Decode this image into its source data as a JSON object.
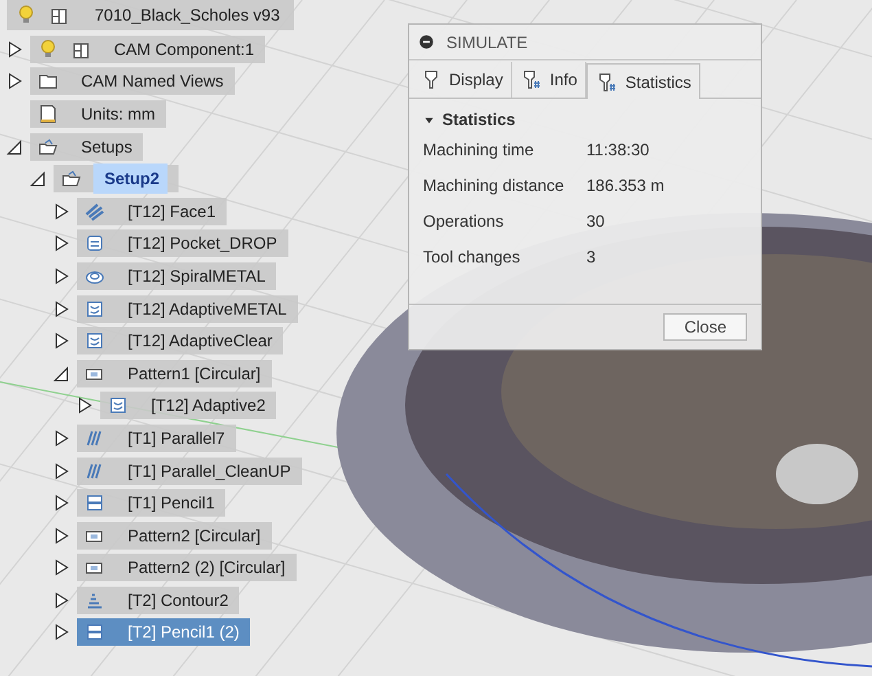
{
  "document": {
    "title": "7010_Black_Scholes v93",
    "visible": true
  },
  "browser_tree": [
    {
      "label": "CAM Component:1",
      "kind": "component",
      "visible": true,
      "expanded": false,
      "selected": false
    },
    {
      "label": "CAM Named Views",
      "kind": "folder",
      "expanded": false,
      "selected": false
    },
    {
      "label": "Units: mm",
      "kind": "units",
      "selected": false
    },
    {
      "label": "Setups",
      "kind": "setup",
      "expanded": true,
      "selected": false,
      "children": [
        {
          "label": "Setup2",
          "kind": "setup",
          "expanded": true,
          "selected": false,
          "current": true,
          "children": [
            {
              "label": "[T12] Face1",
              "kind": "face",
              "expanded": false,
              "selected": false
            },
            {
              "label": "[T12] Pocket_DROP",
              "kind": "pocket",
              "expanded": false,
              "selected": false
            },
            {
              "label": "[T12] SpiralMETAL",
              "kind": "spiral",
              "expanded": false,
              "selected": false
            },
            {
              "label": "[T12] AdaptiveMETAL",
              "kind": "adaptive",
              "expanded": false,
              "selected": false
            },
            {
              "label": "[T12] AdaptiveClear",
              "kind": "adaptive",
              "expanded": false,
              "selected": false
            },
            {
              "label": "Pattern1 [Circular]",
              "kind": "pattern",
              "expanded": true,
              "selected": false,
              "children": [
                {
                  "label": "[T12] Adaptive2",
                  "kind": "adaptive",
                  "expanded": false,
                  "selected": false
                }
              ]
            },
            {
              "label": "[T1] Parallel7",
              "kind": "parallel",
              "expanded": false,
              "selected": false
            },
            {
              "label": "[T1] Parallel_CleanUP",
              "kind": "parallel",
              "expanded": false,
              "selected": false
            },
            {
              "label": "[T1] Pencil1",
              "kind": "pencil",
              "expanded": false,
              "selected": false
            },
            {
              "label": "Pattern2 [Circular]",
              "kind": "pattern",
              "expanded": false,
              "selected": false
            },
            {
              "label": "Pattern2 (2) [Circular]",
              "kind": "pattern",
              "expanded": false,
              "selected": false
            },
            {
              "label": "[T2] Contour2",
              "kind": "contour",
              "expanded": false,
              "selected": false
            },
            {
              "label": "[T2] Pencil1 (2)",
              "kind": "pencil",
              "expanded": false,
              "selected": true
            }
          ]
        }
      ]
    }
  ],
  "dialog": {
    "title": "SIMULATE",
    "tabs": [
      {
        "label": "Display",
        "selected": false
      },
      {
        "label": "Info",
        "selected": false
      },
      {
        "label": "Statistics",
        "selected": true
      }
    ],
    "section": {
      "title": "Statistics",
      "expanded": true
    },
    "rows": [
      {
        "label": "Machining time",
        "value": "11:38:30"
      },
      {
        "label": "Machining distance",
        "value": "186.353 m"
      },
      {
        "label": "Operations",
        "value": "30"
      },
      {
        "label": "Tool changes",
        "value": "3"
      }
    ],
    "buttons": [
      "Close"
    ]
  }
}
